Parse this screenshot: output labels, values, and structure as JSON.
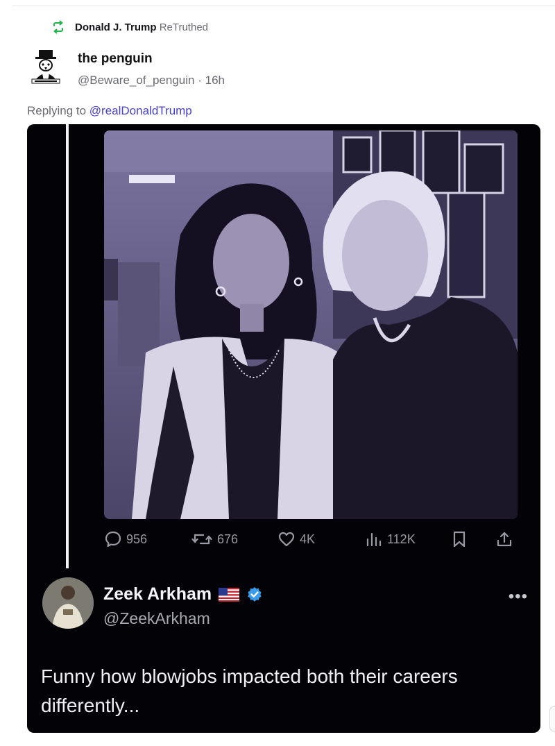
{
  "retruth": {
    "user": "Donald J. Trump",
    "action": "ReTruthed",
    "icon": "retruth-icon",
    "icon_color": "#1fb44a"
  },
  "post": {
    "display_name": "the penguin",
    "handle": "@Beware_of_penguin",
    "separator": "·",
    "time": "16h",
    "replying_prefix": "Replying to",
    "replying_mention": "@realDonaldTrump",
    "mention_color": "#4a42c8"
  },
  "media": {
    "stats": {
      "replies": "956",
      "reposts": "676",
      "likes": "4K",
      "views": "112K"
    },
    "quoted": {
      "name": "Zeek Arkham",
      "flag": "us-flag",
      "verified": "verified-badge-icon",
      "handle": "@ZeekArkham",
      "more": "•••",
      "text": "Funny how blowjobs impacted both their careers differently..."
    }
  }
}
